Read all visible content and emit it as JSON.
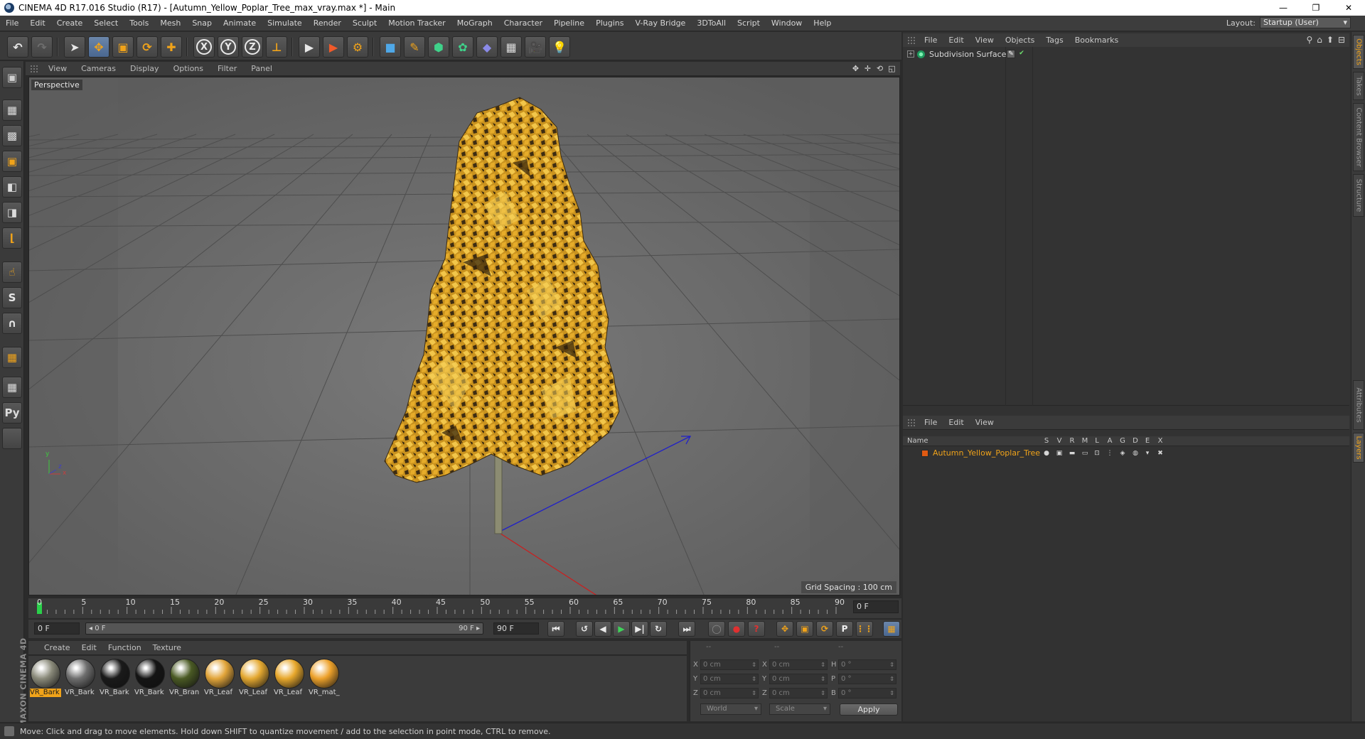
{
  "window": {
    "title": "CINEMA 4D R17.016 Studio (R17) - [Autumn_Yellow_Poplar_Tree_max_vray.max *] - Main",
    "min": "—",
    "max": "❐",
    "close": "✕"
  },
  "menu": [
    "File",
    "Edit",
    "Create",
    "Select",
    "Tools",
    "Mesh",
    "Snap",
    "Animate",
    "Simulate",
    "Render",
    "Sculpt",
    "Motion Tracker",
    "MoGraph",
    "Character",
    "Pipeline",
    "Plugins",
    "V-Ray Bridge",
    "3DToAll",
    "Script",
    "Window",
    "Help"
  ],
  "layout": {
    "label": "Layout:",
    "value": "Startup (User)"
  },
  "toolbar": {
    "undo": "↶",
    "redo": "↷",
    "select": "➤",
    "move": "✥",
    "scale": "▣",
    "rotate": "⟳",
    "last": "✚",
    "x": "X",
    "y": "Y",
    "z": "Z",
    "coord": "⊥",
    "render_view": "▶",
    "render_pv": "▶",
    "render_settings": "⚙",
    "cube": "■",
    "pen": "✎",
    "subdiv": "⬢",
    "cloner": "✿",
    "deformer": "◆",
    "floor": "▦",
    "camera": "🎥",
    "light": "💡"
  },
  "left_tools": [
    "▣",
    "▦",
    "▩",
    "▣",
    "◧",
    "◨",
    "⌊",
    "☝",
    "S",
    "∩",
    "▦",
    "▦",
    "Py"
  ],
  "maxon": "MAXON CINEMA 4D",
  "viewport": {
    "menu": [
      "View",
      "Cameras",
      "Display",
      "Options",
      "Filter",
      "Panel"
    ],
    "nav": [
      "✥",
      "✛",
      "⟲",
      "◱"
    ],
    "label": "Perspective",
    "grid_spacing": "Grid Spacing : 100 cm",
    "axis": {
      "x": "x",
      "y": "y",
      "z": "z"
    }
  },
  "timeline": {
    "ticks": [
      "0",
      "5",
      "10",
      "15",
      "20",
      "25",
      "30",
      "35",
      "40",
      "45",
      "50",
      "55",
      "60",
      "65",
      "70",
      "75",
      "80",
      "85",
      "90"
    ],
    "current": "0 F"
  },
  "transport": {
    "start": "0 F",
    "slider_start": "◂ 0 F",
    "slider_end": "90 F ▸",
    "end": "90 F",
    "buttons": [
      "⏮",
      "↺",
      "◀",
      "▶",
      "▶|",
      "↻",
      "⏭"
    ],
    "key_buttons": [
      "◯",
      "●",
      "?",
      "✥",
      "▣",
      "⟳",
      "P",
      "⋮⋮"
    ]
  },
  "materials": {
    "menu": [
      "Create",
      "Edit",
      "Function",
      "Texture"
    ],
    "items": [
      {
        "name": "VR_Bark",
        "color": "#8a8a7a"
      },
      {
        "name": "VR_Bark",
        "color": "#6e6e6e"
      },
      {
        "name": "VR_Bark",
        "color": "#1a1a1a"
      },
      {
        "name": "VR_Bark",
        "color": "#141414"
      },
      {
        "name": "VR_Bran",
        "color": "#4a5a24"
      },
      {
        "name": "VR_Leaf",
        "color": "#e2a53a"
      },
      {
        "name": "VR_Leaf",
        "color": "#e4a830"
      },
      {
        "name": "VR_Leaf",
        "color": "#e8a82c"
      },
      {
        "name": "VR_mat_",
        "color": "#eda12a"
      }
    ]
  },
  "coords": {
    "headers": [
      "--",
      "--",
      "--"
    ],
    "labels": [
      "X",
      "Y",
      "Z",
      "X",
      "Y",
      "Z",
      "H",
      "P",
      "B"
    ],
    "values": [
      "0 cm",
      "0 cm",
      "0 cm",
      "0 cm",
      "0 cm",
      "0 cm",
      "0 °",
      "0 °",
      "0 °"
    ],
    "world": "World",
    "scale": "Scale",
    "apply": "Apply"
  },
  "status": "Move: Click and drag to move elements. Hold down SHIFT to quantize movement / add to the selection in point mode, CTRL to remove.",
  "objects": {
    "menu": [
      "File",
      "Edit",
      "View",
      "Objects",
      "Tags",
      "Bookmarks"
    ],
    "tools": [
      "⚲",
      "⌂",
      "⬆",
      "⊟"
    ],
    "row": {
      "name": "Subdivision Surface",
      "tree": "+",
      "tag": "✎",
      "check": "✔"
    }
  },
  "layers": {
    "menu": [
      "File",
      "Edit",
      "View"
    ],
    "name_header": "Name",
    "cols": [
      "S",
      "V",
      "R",
      "M",
      "L",
      "A",
      "G",
      "D",
      "E",
      "X"
    ],
    "row": {
      "name": "Autumn_Yellow_Poplar_Tree",
      "icons": [
        "●",
        "▣",
        "▬",
        "▭",
        "⊡",
        "⋮",
        "◈",
        "◍",
        "▾",
        "✖"
      ]
    }
  },
  "vtabs": [
    "Objects",
    "Takes",
    "Content Browser",
    "Structure",
    "Attributes",
    "Layers"
  ]
}
